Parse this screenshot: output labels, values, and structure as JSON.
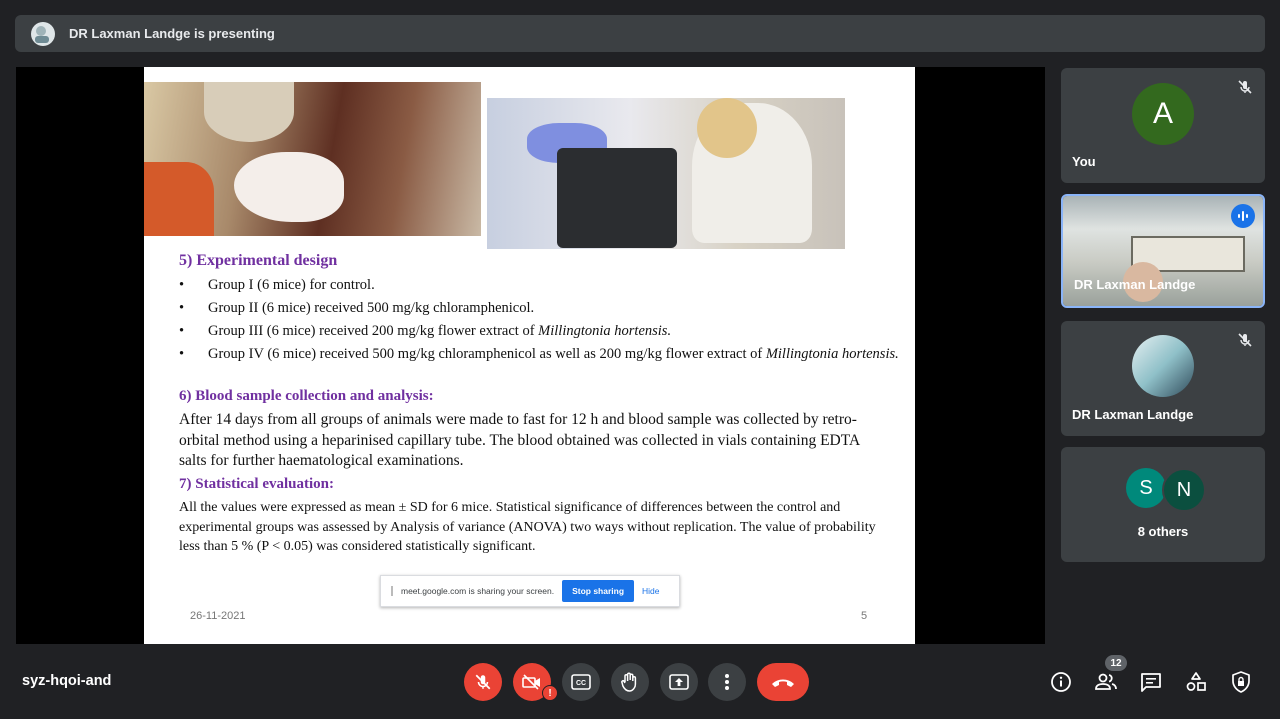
{
  "banner": {
    "text": "DR Laxman Landge is presenting"
  },
  "slide": {
    "sections": [
      {
        "heading": "5) Experimental design",
        "bullets": [
          "Group I (6 mice) for control.",
          "Group II (6 mice) received 500 mg/kg chloramphenicol.",
          "Group III (6 mice) received 200 mg/kg flower extract of ",
          "Group IV (6 mice) received 500 mg/kg chloramphenicol as well as 200 mg/kg flower extract of "
        ],
        "species": "Millingtonia hortensis.",
        "species_g4": "Millingtonia hortensis."
      },
      {
        "heading": "6) Blood sample collection and analysis:",
        "text": "After 14 days from all groups of animals were made to fast for 12 h and blood sample was collected by retro-orbital method using a heparinised capillary tube. The blood obtained was collected in vials containing EDTA salts for further haematological examinations."
      },
      {
        "heading": "7) Statistical evaluation:",
        "text": "All the values were expressed as mean ± SD for 6 mice. Statistical significance of differences between the control and experimental groups was assessed by Analysis of variance (ANOVA) two ways without replication. The value of probability less than 5 % (P < 0.05) was considered statistically significant."
      }
    ],
    "date": "26-11-2021",
    "page": "5",
    "bullet_char": "•"
  },
  "sharebar": {
    "text": "meet.google.com is sharing your screen.",
    "stop": "Stop sharing",
    "hide": "Hide"
  },
  "participants": {
    "you": {
      "initial": "A",
      "name": "You"
    },
    "presenter_cam": {
      "name": "DR Laxman Landge"
    },
    "presenter": {
      "name": "DR Laxman Landge"
    },
    "others": {
      "initials": [
        "S",
        "N"
      ],
      "label": "8 others"
    }
  },
  "bottom": {
    "meeting_code": "syz-hqoi-and",
    "alert": "!",
    "people_count": "12"
  },
  "colors": {
    "end_call": "#ea4335",
    "accent": "#1a73e8",
    "heading": "#7030a0"
  }
}
